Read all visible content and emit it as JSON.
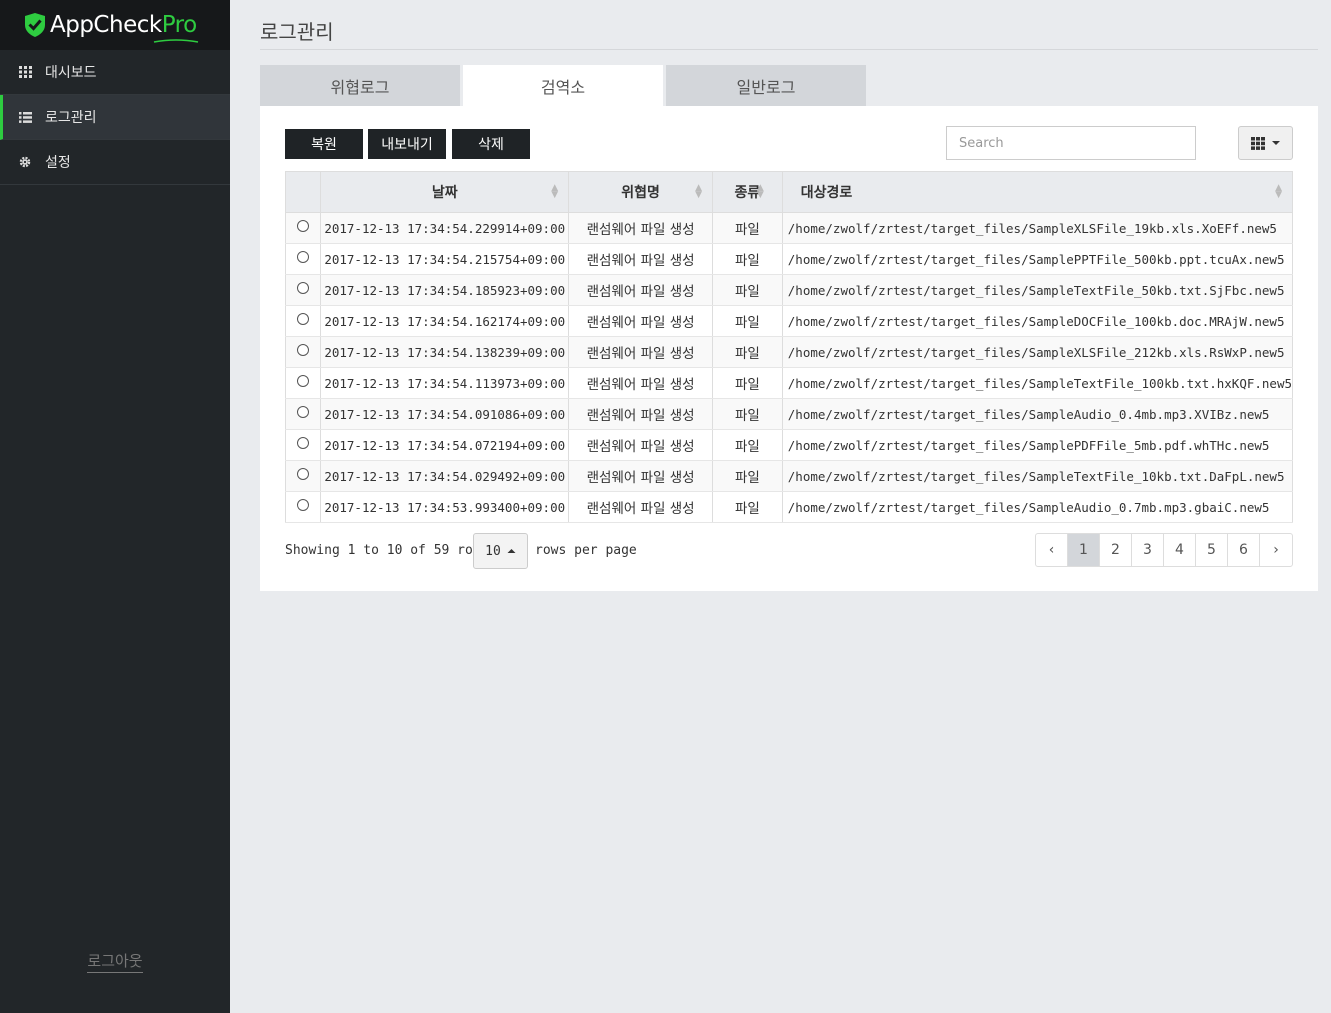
{
  "app": {
    "logo_main": "AppCheck",
    "logo_pro": "Pro",
    "brand_color": "#2ecc40"
  },
  "sidebar": {
    "items": [
      {
        "label": "대시보드",
        "icon": "grid-icon"
      },
      {
        "label": "로그관리",
        "icon": "list-icon",
        "active": true
      },
      {
        "label": "설정",
        "icon": "gear-icon"
      }
    ],
    "logout": "로그아웃"
  },
  "page": {
    "title": "로그관리"
  },
  "tabs": [
    {
      "label": "위협로그"
    },
    {
      "label": "검역소",
      "active": true
    },
    {
      "label": "일반로그"
    }
  ],
  "toolbar": {
    "restore": "복원",
    "export": "내보내기",
    "delete": "삭제",
    "search_placeholder": "Search"
  },
  "table": {
    "headers": {
      "date": "날짜",
      "threat": "위협명",
      "type": "종류",
      "path": "대상경로"
    },
    "rows": [
      {
        "date": "2017-12-13 17:34:54.229914+09:00",
        "threat": "랜섬웨어 파일 생성",
        "type": "파일",
        "path": "/home/zwolf/zrtest/target_files/SampleXLSFile_19kb.xls.XoEFf.new5"
      },
      {
        "date": "2017-12-13 17:34:54.215754+09:00",
        "threat": "랜섬웨어 파일 생성",
        "type": "파일",
        "path": "/home/zwolf/zrtest/target_files/SamplePPTFile_500kb.ppt.tcuAx.new5"
      },
      {
        "date": "2017-12-13 17:34:54.185923+09:00",
        "threat": "랜섬웨어 파일 생성",
        "type": "파일",
        "path": "/home/zwolf/zrtest/target_files/SampleTextFile_50kb.txt.SjFbc.new5"
      },
      {
        "date": "2017-12-13 17:34:54.162174+09:00",
        "threat": "랜섬웨어 파일 생성",
        "type": "파일",
        "path": "/home/zwolf/zrtest/target_files/SampleDOCFile_100kb.doc.MRAjW.new5"
      },
      {
        "date": "2017-12-13 17:34:54.138239+09:00",
        "threat": "랜섬웨어 파일 생성",
        "type": "파일",
        "path": "/home/zwolf/zrtest/target_files/SampleXLSFile_212kb.xls.RsWxP.new5"
      },
      {
        "date": "2017-12-13 17:34:54.113973+09:00",
        "threat": "랜섬웨어 파일 생성",
        "type": "파일",
        "path": "/home/zwolf/zrtest/target_files/SampleTextFile_100kb.txt.hxKQF.new5"
      },
      {
        "date": "2017-12-13 17:34:54.091086+09:00",
        "threat": "랜섬웨어 파일 생성",
        "type": "파일",
        "path": "/home/zwolf/zrtest/target_files/SampleAudio_0.4mb.mp3.XVIBz.new5"
      },
      {
        "date": "2017-12-13 17:34:54.072194+09:00",
        "threat": "랜섬웨어 파일 생성",
        "type": "파일",
        "path": "/home/zwolf/zrtest/target_files/SamplePDFFile_5mb.pdf.whTHc.new5"
      },
      {
        "date": "2017-12-13 17:34:54.029492+09:00",
        "threat": "랜섬웨어 파일 생성",
        "type": "파일",
        "path": "/home/zwolf/zrtest/target_files/SampleTextFile_10kb.txt.DaFpL.new5"
      },
      {
        "date": "2017-12-13 17:34:53.993400+09:00",
        "threat": "랜섬웨어 파일 생성",
        "type": "파일",
        "path": "/home/zwolf/zrtest/target_files/SampleAudio_0.7mb.mp3.gbaiC.new5"
      }
    ]
  },
  "footer": {
    "showing": "Showing 1 to 10 of 59 rows",
    "page_size": "10",
    "rows_per_page": "rows per page",
    "pages": [
      "‹",
      "1",
      "2",
      "3",
      "4",
      "5",
      "6",
      "›"
    ],
    "active_page": "1"
  }
}
